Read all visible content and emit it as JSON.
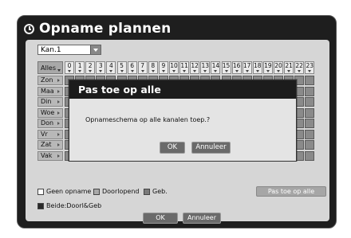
{
  "window": {
    "title": "Opname plannen"
  },
  "channel": {
    "selected": "Kan.1"
  },
  "grid": {
    "all_label": "Alles",
    "hours": [
      "0",
      "1",
      "2",
      "3",
      "4",
      "5",
      "6",
      "7",
      "8",
      "9",
      "10",
      "11",
      "12",
      "13",
      "14",
      "15",
      "16",
      "17",
      "18",
      "19",
      "20",
      "21",
      "22",
      "23"
    ],
    "days": [
      "Zon",
      "Maa",
      "Din",
      "Woe",
      "Don",
      "Vr",
      "Zat",
      "Vak"
    ]
  },
  "legend": {
    "items": [
      {
        "label": "Geen opname",
        "color": "#ffffff"
      },
      {
        "label": "Doorlopend",
        "color": "#a8a8a8"
      },
      {
        "label": "Geb.",
        "color": "#7a7a7a"
      },
      {
        "label": "Beide:Doorl&Geb",
        "color": "#2a2a2a"
      }
    ]
  },
  "apply_all_button": "Pas toe op alle",
  "footer": {
    "ok": "OK",
    "cancel": "Annuleer"
  },
  "dialog": {
    "title": "Pas toe op alle",
    "message": "Opnameschema op alle kanalen toep.?",
    "ok": "OK",
    "cancel": "Annuleer"
  }
}
